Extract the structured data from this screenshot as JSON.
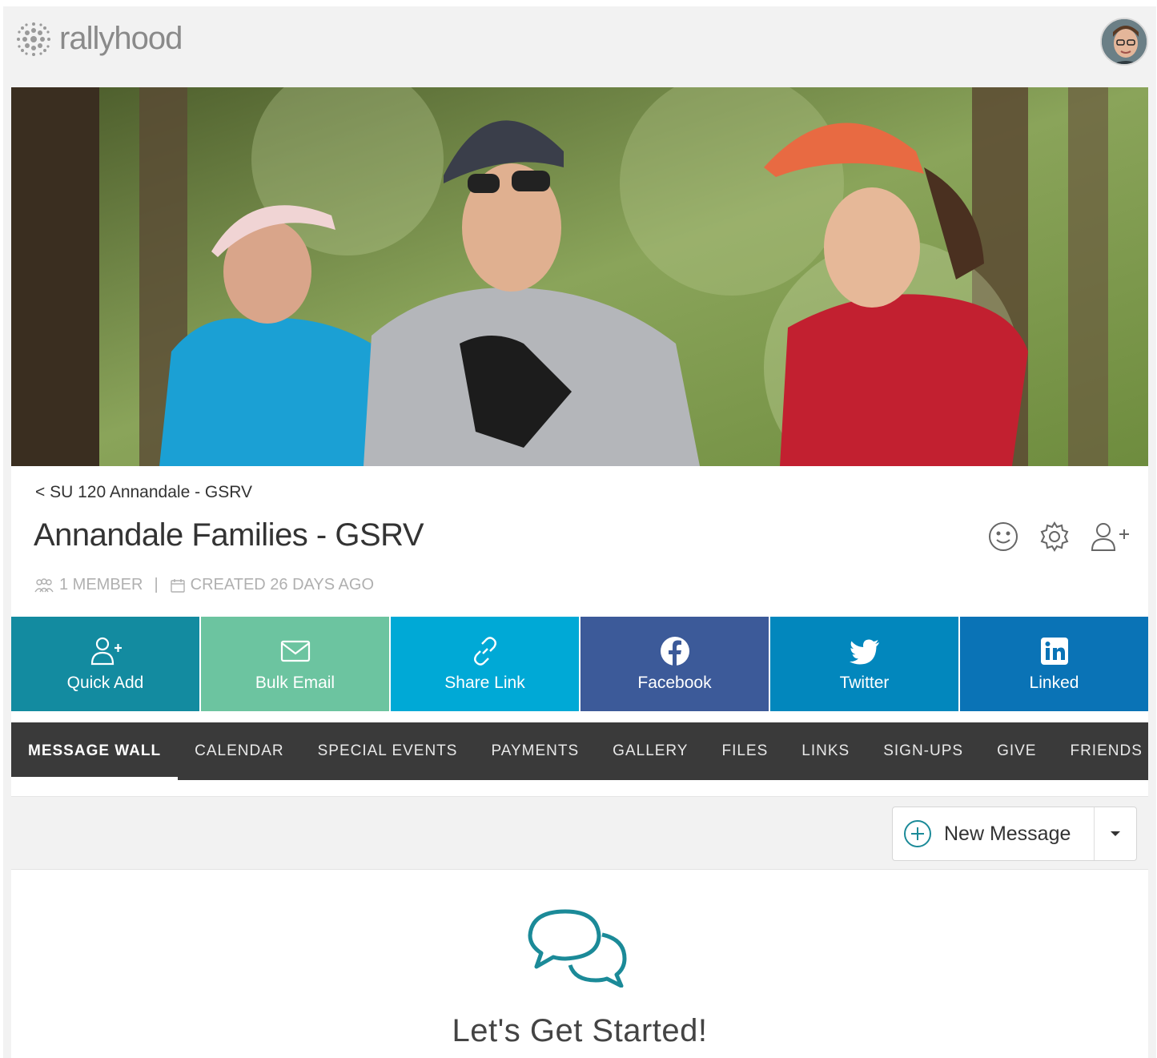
{
  "app": {
    "logo_text": "rallyhood",
    "avatar_alt": "user-avatar"
  },
  "group": {
    "breadcrumb": "< SU 120 Annandale - GSRV",
    "title": "Annandale Families - GSRV",
    "members": "1 MEMBER",
    "separator": "|",
    "created": "CREATED 26 DAYS AGO"
  },
  "share_buttons": [
    {
      "label": "Quick Add",
      "icon": "add-user-icon",
      "color": "#138ba0"
    },
    {
      "label": "Bulk Email",
      "icon": "envelope-icon",
      "color": "#6cc4a0"
    },
    {
      "label": "Share Link",
      "icon": "link-icon",
      "color": "#00a9d6"
    },
    {
      "label": "Facebook",
      "icon": "facebook-icon",
      "color": "#3c5a99"
    },
    {
      "label": "Twitter",
      "icon": "twitter-icon",
      "color": "#0287bd"
    },
    {
      "label": "Linked",
      "icon": "linkedin-icon",
      "color": "#0a73b6"
    }
  ],
  "tabs": [
    "MESSAGE WALL",
    "CALENDAR",
    "SPECIAL EVENTS",
    "PAYMENTS",
    "GALLERY",
    "FILES",
    "LINKS",
    "SIGN-UPS",
    "GIVE",
    "FRIENDS"
  ],
  "active_tab": "MESSAGE WALL",
  "message_wall": {
    "new_message_label": "New Message",
    "empty_title": "Let's Get Started!"
  },
  "colors": {
    "tab_bar": "#3a3a3a",
    "teal": "#1b8a98"
  }
}
